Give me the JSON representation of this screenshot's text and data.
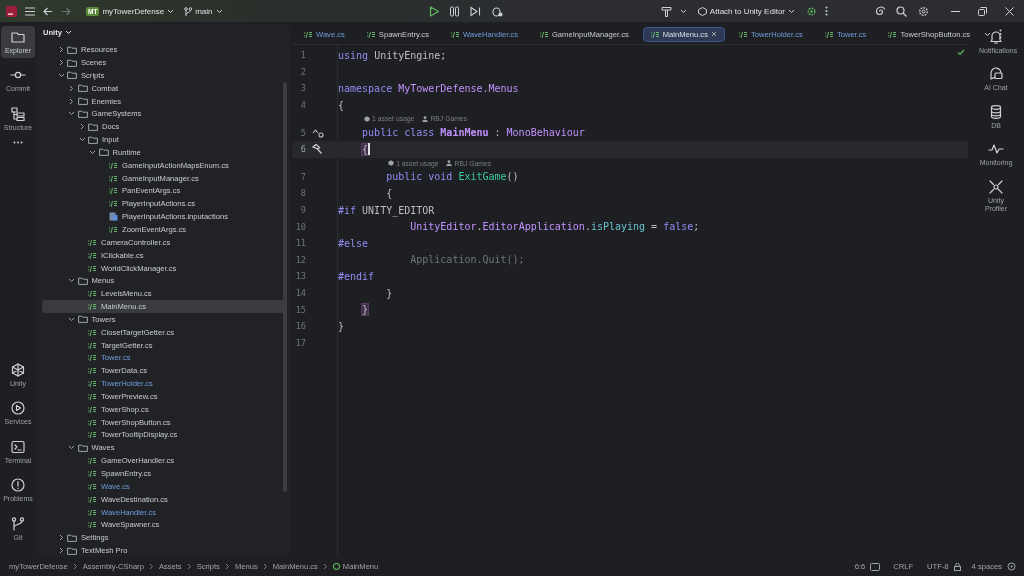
{
  "title_bar": {
    "project_badge": "MT",
    "project": "myTowerDefense",
    "branch": "main",
    "run_config": "Attach to Unity Editor"
  },
  "left_tools": [
    {
      "label": "Explorer",
      "selected": true
    },
    {
      "label": "Commit",
      "selected": false
    },
    {
      "label": "Structure",
      "selected": false
    },
    {
      "label": "Unity",
      "selected": false
    },
    {
      "label": "Services",
      "selected": false
    },
    {
      "label": "Terminal",
      "selected": false
    },
    {
      "label": "Problems",
      "selected": false
    },
    {
      "label": "Git",
      "selected": false
    }
  ],
  "explorer": {
    "header": "Unity",
    "tree": [
      {
        "name": "Resources",
        "kind": "folder",
        "expanded": false,
        "selected": false
      },
      {
        "name": "Scenes",
        "kind": "folder",
        "expanded": false,
        "selected": false
      },
      {
        "name": "Scripts",
        "kind": "folder",
        "expanded": true,
        "selected": false,
        "children": [
          {
            "name": "Combat",
            "kind": "folder",
            "expanded": false,
            "selected": false
          },
          {
            "name": "Enemies",
            "kind": "folder",
            "expanded": false,
            "selected": false
          },
          {
            "name": "GameSystems",
            "kind": "folder",
            "expanded": true,
            "selected": false,
            "children": [
              {
                "name": "Docs",
                "kind": "folder",
                "expanded": false,
                "selected": false
              },
              {
                "name": "Input",
                "kind": "folder",
                "expanded": true,
                "selected": false,
                "children": [
                  {
                    "name": "Runtime",
                    "kind": "folder",
                    "expanded": true,
                    "selected": false,
                    "children": [
                      {
                        "name": "GameInputActionMapsEnum.cs",
                        "kind": "cs",
                        "selected": false,
                        "modified": false
                      },
                      {
                        "name": "GameInputManager.cs",
                        "kind": "cs",
                        "selected": false,
                        "modified": false
                      },
                      {
                        "name": "PanEventArgs.cs",
                        "kind": "cs",
                        "selected": false,
                        "modified": false
                      },
                      {
                        "name": "PlayerInputActions.cs",
                        "kind": "cs",
                        "selected": false,
                        "modified": false
                      },
                      {
                        "name": "PlayerInputActions.inputactions",
                        "kind": "asset",
                        "selected": false,
                        "modified": false
                      },
                      {
                        "name": "ZoomEventArgs.cs",
                        "kind": "cs",
                        "selected": false,
                        "modified": false
                      }
                    ]
                  }
                ]
              },
              {
                "name": "CameraController.cs",
                "kind": "cs",
                "selected": false,
                "modified": false
              },
              {
                "name": "IClickable.cs",
                "kind": "cs",
                "selected": false,
                "modified": false
              },
              {
                "name": "WorldClickManager.cs",
                "kind": "cs",
                "selected": false,
                "modified": false
              }
            ]
          },
          {
            "name": "Menus",
            "kind": "folder",
            "expanded": true,
            "selected": false,
            "children": [
              {
                "name": "LevelsMenu.cs",
                "kind": "cs",
                "selected": false,
                "modified": false
              },
              {
                "name": "MainMenu.cs",
                "kind": "cs",
                "selected": true,
                "modified": false
              }
            ]
          },
          {
            "name": "Towers",
            "kind": "folder",
            "expanded": true,
            "selected": false,
            "children": [
              {
                "name": "ClosetTargetGetter.cs",
                "kind": "cs",
                "selected": false,
                "modified": false
              },
              {
                "name": "TargetGetter.cs",
                "kind": "cs",
                "selected": false,
                "modified": false
              },
              {
                "name": "Tower.cs",
                "kind": "cs",
                "selected": false,
                "modified": true
              },
              {
                "name": "TowerData.cs",
                "kind": "cs",
                "selected": false,
                "modified": false
              },
              {
                "name": "TowerHolder.cs",
                "kind": "cs",
                "selected": false,
                "modified": true
              },
              {
                "name": "TowerPreview.cs",
                "kind": "cs",
                "selected": false,
                "modified": false
              },
              {
                "name": "TowerShop.cs",
                "kind": "cs",
                "selected": false,
                "modified": false
              },
              {
                "name": "TowerShopButton.cs",
                "kind": "cs",
                "selected": false,
                "modified": false
              },
              {
                "name": "TowerTooltipDisplay.cs",
                "kind": "cs",
                "selected": false,
                "modified": false
              }
            ]
          },
          {
            "name": "Waves",
            "kind": "folder",
            "expanded": true,
            "selected": false,
            "children": [
              {
                "name": "GameOverHandler.cs",
                "kind": "cs",
                "selected": false,
                "modified": false
              },
              {
                "name": "SpawnEntry.cs",
                "kind": "cs",
                "selected": false,
                "modified": false
              },
              {
                "name": "Wave.cs",
                "kind": "cs",
                "selected": false,
                "modified": true
              },
              {
                "name": "WaveDestination.cs",
                "kind": "cs",
                "selected": false,
                "modified": false
              },
              {
                "name": "WaveHandler.cs",
                "kind": "cs",
                "selected": false,
                "modified": true
              },
              {
                "name": "WaveSpawner.cs",
                "kind": "cs",
                "selected": false,
                "modified": false
              }
            ]
          }
        ]
      },
      {
        "name": "Settings",
        "kind": "folder",
        "expanded": false,
        "selected": false
      },
      {
        "name": "TextMesh Pro",
        "kind": "folder",
        "expanded": false,
        "selected": false
      }
    ]
  },
  "tabs": [
    {
      "label": "Wave.cs",
      "selected": false,
      "modified": true
    },
    {
      "label": "SpawnEntry.cs",
      "selected": false,
      "modified": false
    },
    {
      "label": "WaveHandler.cs",
      "selected": false,
      "modified": true
    },
    {
      "label": "GameInputManager.cs",
      "selected": false,
      "modified": false
    },
    {
      "label": "MainMenu.cs",
      "selected": true,
      "modified": false
    },
    {
      "label": "TowerHolder.cs",
      "selected": false,
      "modified": true
    },
    {
      "label": "Tower.cs",
      "selected": false,
      "modified": true
    },
    {
      "label": "TowerShopButton.cs",
      "selected": false,
      "modified": false
    }
  ],
  "code": [
    {
      "kind": "line",
      "number": "1",
      "current": false,
      "tokens": [
        {
          "text": "using",
          "kind": "kw"
        },
        {
          "text": " UnityEngine;",
          "kind": "plain"
        }
      ]
    },
    {
      "kind": "line",
      "number": "2",
      "current": false
    },
    {
      "kind": "line",
      "number": "3",
      "current": false,
      "tokens": [
        {
          "text": "namespace",
          "kind": "kw"
        },
        {
          "text": " MyTowerDefense.Menus",
          "kind": "ns"
        }
      ]
    },
    {
      "kind": "line",
      "number": "4",
      "current": false,
      "tokens": [
        {
          "text": "{",
          "kind": "plain"
        }
      ]
    },
    {
      "kind": "inlay",
      "usage": "1 asset usage",
      "author": "RBJ Games"
    },
    {
      "kind": "line",
      "number": "5",
      "current": false,
      "gutter": {
        "kind": "implements"
      },
      "tokens": [
        {
          "text": "    public class",
          "kind": "kw"
        },
        {
          "text": " MainMenu",
          "kind": "cls"
        },
        {
          "text": " : ",
          "kind": "plain"
        },
        {
          "text": "MonoBehaviour",
          "kind": "type"
        }
      ]
    },
    {
      "kind": "line",
      "number": "6",
      "current": true,
      "gutter": {
        "kind": "hammer"
      },
      "tokens": [
        {
          "text": "    {",
          "kind": "brace"
        }
      ]
    },
    {
      "kind": "inlay",
      "usage": "1 asset usage",
      "author": "RBJ Games"
    },
    {
      "kind": "line",
      "number": "7",
      "current": false,
      "tokens": [
        {
          "text": "        public void",
          "kind": "kw"
        },
        {
          "text": " ExitGame",
          "kind": "method"
        },
        {
          "text": "()",
          "kind": "plain"
        }
      ]
    },
    {
      "kind": "line",
      "number": "8",
      "current": false,
      "tokens": [
        {
          "text": "        {",
          "kind": "plain"
        }
      ]
    },
    {
      "kind": "line",
      "number": "9",
      "current": false,
      "tokens": [
        {
          "text": "#if",
          "kind": "kw"
        },
        {
          "text": " UNITY_EDITOR",
          "kind": "plain"
        }
      ]
    },
    {
      "kind": "line",
      "number": "10",
      "current": false,
      "tokens": [
        {
          "text": "            UnityEditor",
          "kind": "ns"
        },
        {
          "text": ".",
          "kind": "plain"
        },
        {
          "text": "EditorApplication",
          "kind": "type"
        },
        {
          "text": ".",
          "kind": "plain"
        },
        {
          "text": "isPlaying",
          "kind": "field"
        },
        {
          "text": " = ",
          "kind": "plain"
        },
        {
          "text": "false",
          "kind": "kw"
        },
        {
          "text": ";",
          "kind": "plain"
        }
      ]
    },
    {
      "kind": "line",
      "number": "11",
      "current": false,
      "tokens": [
        {
          "text": "#else",
          "kind": "kw"
        }
      ]
    },
    {
      "kind": "line",
      "number": "12",
      "current": false,
      "tokens": [
        {
          "text": "            Application.Quit();",
          "kind": "inactive"
        }
      ]
    },
    {
      "kind": "line",
      "number": "13",
      "current": false,
      "tokens": [
        {
          "text": "#endif",
          "kind": "kw"
        }
      ]
    },
    {
      "kind": "line",
      "number": "14",
      "current": false,
      "tokens": [
        {
          "text": "        }",
          "kind": "plain"
        }
      ]
    },
    {
      "kind": "line",
      "number": "15",
      "current": false,
      "tokens": [
        {
          "text": "    }",
          "kind": "brace"
        }
      ]
    },
    {
      "kind": "line",
      "number": "16",
      "current": false,
      "tokens": [
        {
          "text": "}",
          "kind": "plain"
        }
      ]
    },
    {
      "kind": "line",
      "number": "17",
      "current": false
    }
  ],
  "right_tools": [
    {
      "label": "Notifications"
    },
    {
      "label": "AI Chat"
    },
    {
      "label": "DB"
    },
    {
      "label": "Monitoring"
    },
    {
      "label": "Unity Profiler"
    }
  ],
  "status_bar": {
    "breadcrumbs": [
      "myTowerDefense",
      "Assembly-CSharp",
      "Assets",
      "Scripts",
      "Menus",
      "MainMenu.cs",
      "MainMenu"
    ],
    "position": "6:6",
    "line_ending": "CRLF",
    "encoding": "UTF-8",
    "indent": "4 spaces"
  }
}
